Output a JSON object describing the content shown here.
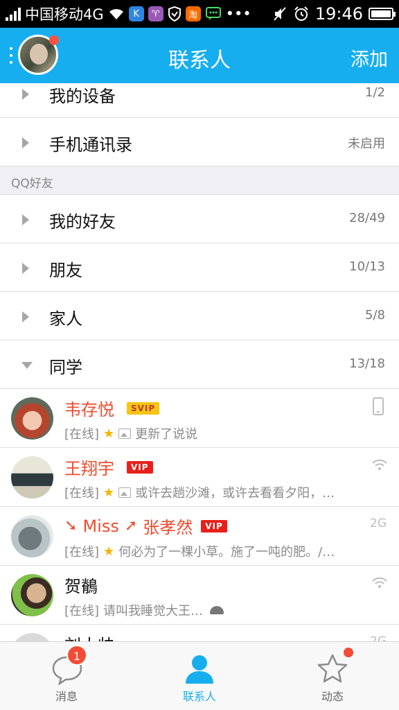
{
  "status_bar": {
    "carrier": "中国移动4G",
    "time": "19:46",
    "app_badges": [
      {
        "icon": "k-app-icon",
        "glyph": "K",
        "color": "#2e86de"
      },
      {
        "icon": "aries-app-icon",
        "glyph": "♈",
        "color": "#9b59b6"
      },
      {
        "icon": "shield-app-icon",
        "glyph": "",
        "color": "#000000"
      },
      {
        "icon": "taobao-app-icon",
        "glyph": "淘",
        "color": "#ff6a00"
      },
      {
        "icon": "wechat-app-icon",
        "glyph": "",
        "color": "#000000"
      }
    ]
  },
  "header": {
    "title": "联系人",
    "add_label": "添加"
  },
  "groups_top": [
    {
      "name": "我的设备",
      "count": "1/2"
    },
    {
      "name": "手机通讯录",
      "count": "未启用"
    }
  ],
  "section_title": "QQ好友",
  "groups": [
    {
      "name": "我的好友",
      "count": "28/49",
      "expanded": false
    },
    {
      "name": "朋友",
      "count": "10/13",
      "expanded": false
    },
    {
      "name": "家人",
      "count": "5/8",
      "expanded": false
    },
    {
      "name": "同学",
      "count": "13/18",
      "expanded": true
    }
  ],
  "friends": [
    {
      "name": "韦存悦",
      "badge": "SVIP",
      "status": "[在线]",
      "text": "更新了说说",
      "indicator": "phone-icon"
    },
    {
      "name": "王翔宇",
      "badge": "VIP",
      "status": "[在线]",
      "text": "或许去趟沙滩，或许去看看夕阳，…",
      "indicator": "wifi-icon"
    },
    {
      "name_prefix": "Miss",
      "name": "张孝然",
      "badge": "VIP",
      "status": "[在线]",
      "text": "何必为了一棵小草。施了一吨的肥。/…",
      "indicator": "2G"
    },
    {
      "name": "贺鶺",
      "badge": "",
      "status": "[在线]",
      "text": "请叫我睡觉大王…",
      "indicator": "wifi-icon"
    },
    {
      "name": "刘大帅",
      "indicator": "2G"
    }
  ],
  "tabs": [
    {
      "label": "消息",
      "icon": "chat-bubble-icon",
      "badge": "1"
    },
    {
      "label": "联系人",
      "icon": "contacts-person-icon",
      "active": true
    },
    {
      "label": "动态",
      "icon": "star-icon",
      "dot": true
    }
  ],
  "colors": {
    "brand_blue": "#17aef0",
    "vip_red": "#e8201b",
    "svip_gold": "#f5c516",
    "name_red": "#ee4b2f"
  }
}
